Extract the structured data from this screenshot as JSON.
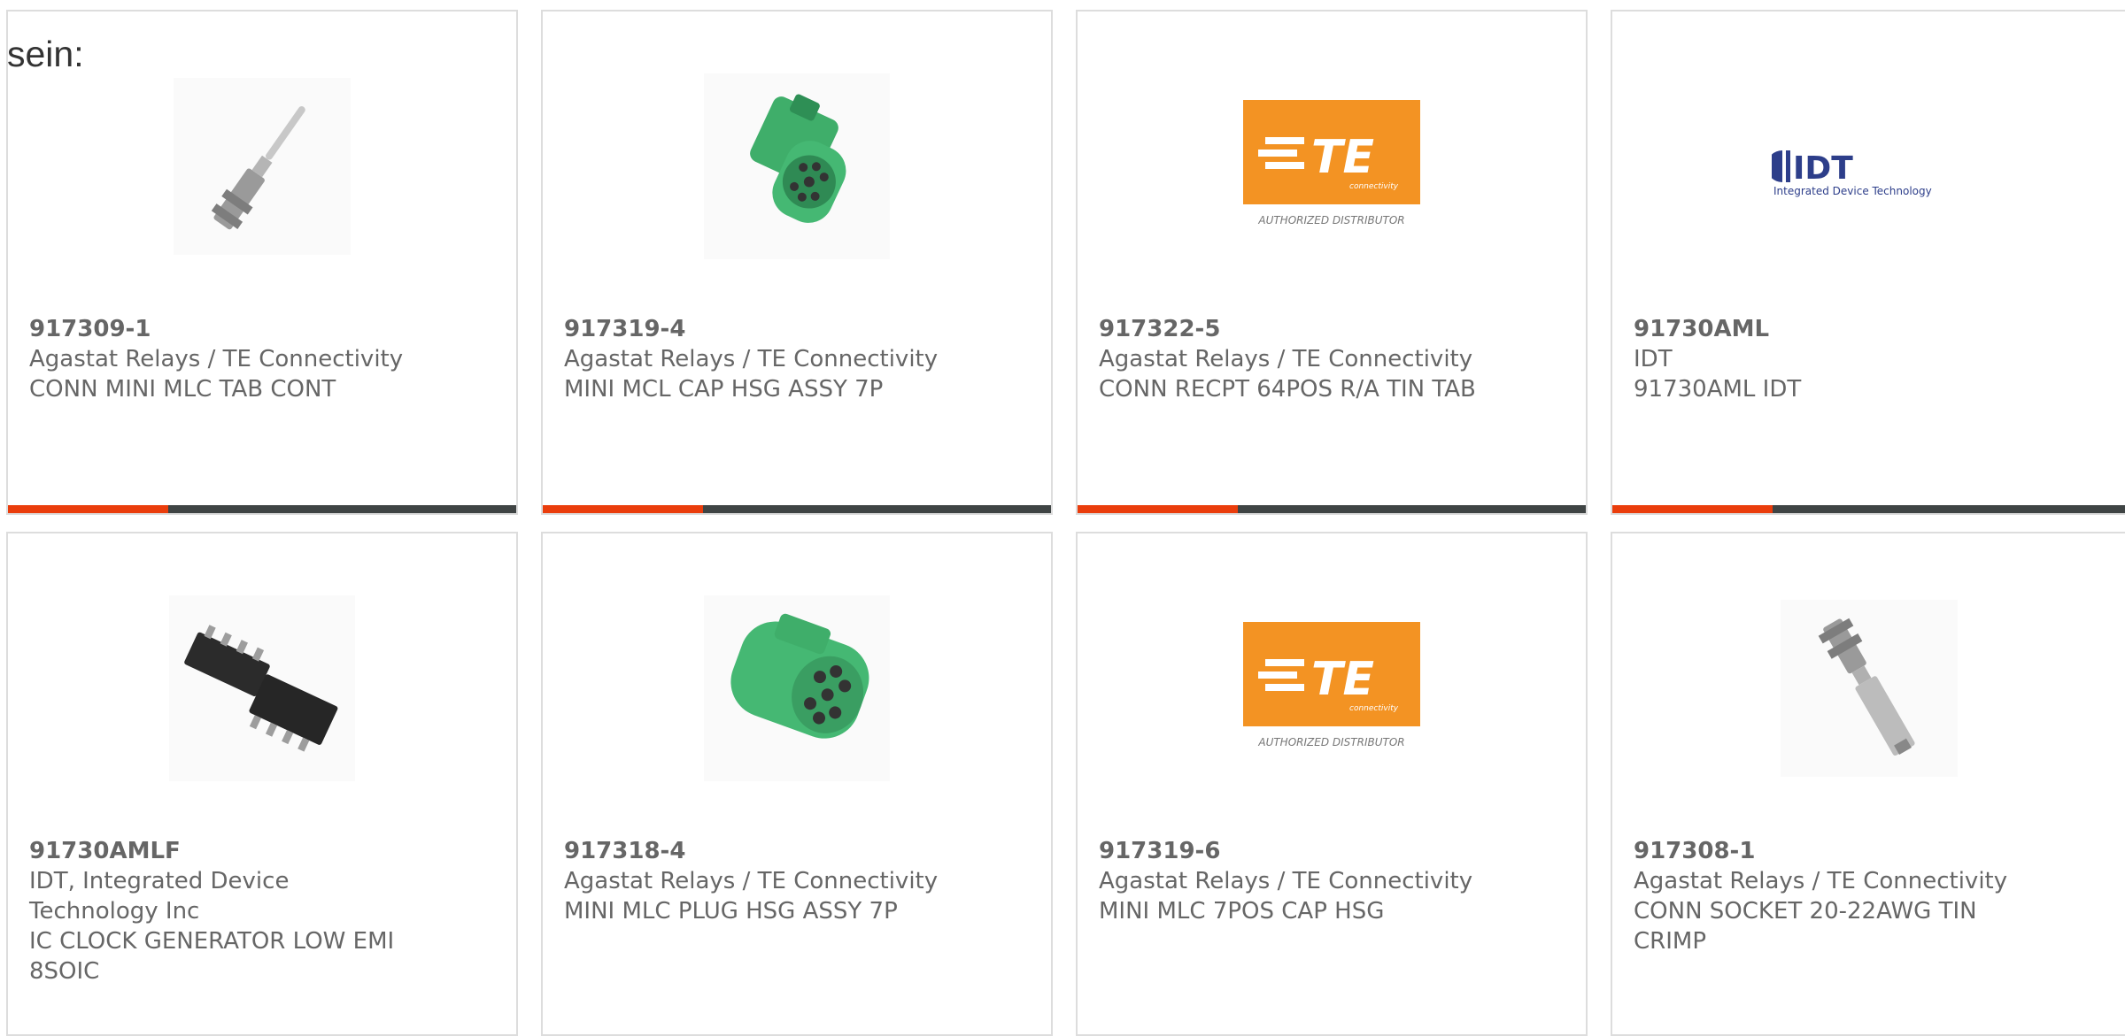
{
  "intro_text": "sein:",
  "colors": {
    "accent": "#ea3d0c",
    "bar_dark": "#3f4444",
    "text": "#666666",
    "te_orange": "#f39323",
    "idt_blue": "#2d3e8a",
    "connector_green": "#3fae6a"
  },
  "cards": [
    {
      "part_number": "917309-1",
      "manufacturer": "Agastat Relays / TE Connectivity",
      "description": "CONN MINI MLC TAB CONT",
      "image": "crimp-tab-contact-icon"
    },
    {
      "part_number": "917319-4",
      "manufacturer": "Agastat Relays / TE Connectivity",
      "description": "MINI MCL CAP HSG ASSY 7P",
      "image": "green-connector-cap-icon"
    },
    {
      "part_number": "917322-5",
      "manufacturer": "Agastat Relays / TE Connectivity",
      "description": "CONN RECPT 64POS R/A TIN TAB",
      "image": "te-logo-icon",
      "logo_text": "TE",
      "logo_sub": "connectivity",
      "logo_caption": "AUTHORIZED DISTRIBUTOR"
    },
    {
      "part_number": "91730AML",
      "manufacturer": "IDT",
      "description": "91730AML IDT",
      "image": "idt-logo-icon",
      "logo_text": "IDT",
      "logo_caption": "Integrated Device Technology"
    },
    {
      "part_number": "91730AMLF",
      "manufacturer": "IDT, Integrated Device Technology Inc",
      "description": "IC CLOCK GENERATOR LOW EMI 8SOIC",
      "image": "soic-chip-icon"
    },
    {
      "part_number": "917318-4",
      "manufacturer": "Agastat Relays / TE Connectivity",
      "description": "MINI MLC PLUG HSG ASSY 7P",
      "image": "green-connector-plug-icon"
    },
    {
      "part_number": "917319-6",
      "manufacturer": "Agastat Relays / TE Connectivity",
      "description": "MINI MLC 7POS CAP HSG",
      "image": "te-logo-icon",
      "logo_text": "TE",
      "logo_sub": "connectivity",
      "logo_caption": "AUTHORIZED DISTRIBUTOR"
    },
    {
      "part_number": "917308-1",
      "manufacturer": "Agastat Relays / TE Connectivity",
      "description": "CONN SOCKET 20-22AWG TIN CRIMP",
      "image": "crimp-socket-contact-icon"
    }
  ]
}
